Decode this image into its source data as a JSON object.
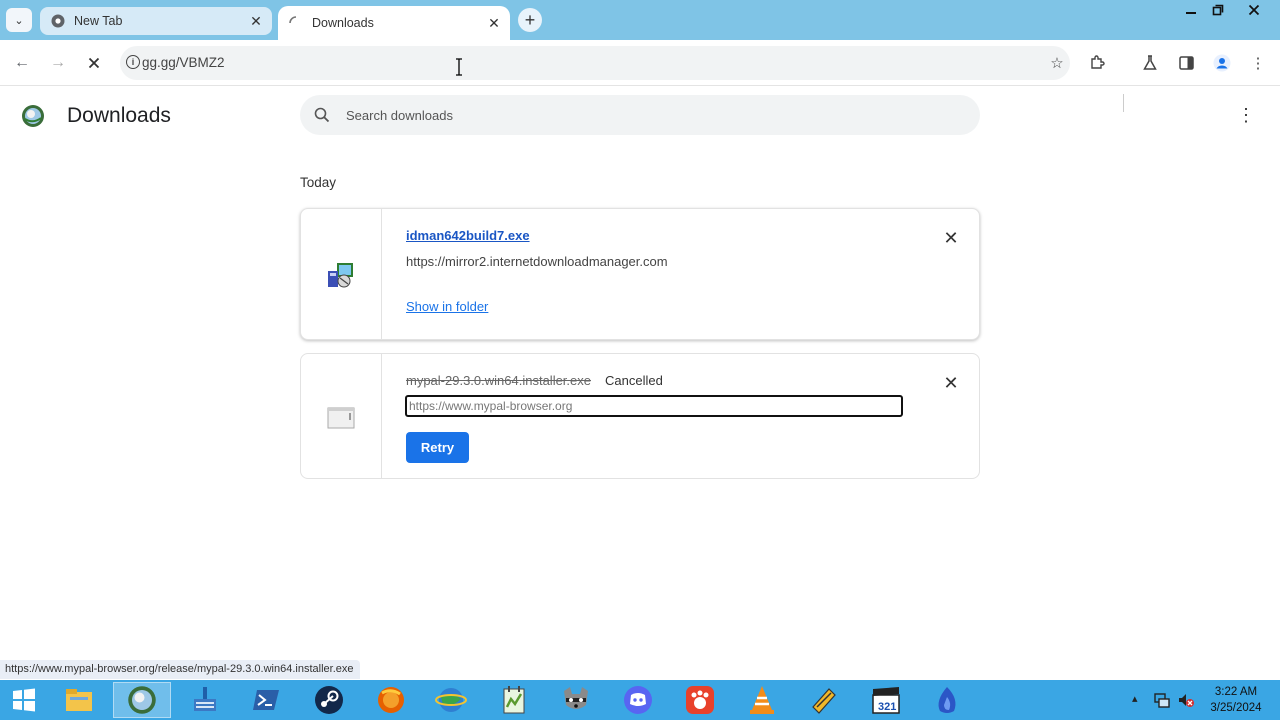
{
  "browser": {
    "tabs": [
      {
        "title": "New Tab",
        "state": "inactive"
      },
      {
        "title": "Downloads",
        "state": "active-loading"
      }
    ],
    "address_bar": {
      "url": "gg.gg/VBMZ2"
    },
    "accent_color": "#7fc4e6"
  },
  "downloads_page": {
    "title": "Downloads",
    "search_placeholder": "Search downloads",
    "section_label": "Today",
    "items": [
      {
        "filename": "idman642build7.exe",
        "source_url": "https://mirror2.internetdownloadmanager.com",
        "action_link": "Show in folder",
        "status": ""
      },
      {
        "filename": "mypal-29.3.0.win64.installer.exe",
        "source_url": "https://www.mypal-browser.org",
        "action_button": "Retry",
        "status": "Cancelled"
      }
    ]
  },
  "status_bar": {
    "hover_url": "https://www.mypal-browser.org/release/mypal-29.3.0.win64.installer.exe"
  },
  "taskbar": {
    "apps": [
      "file-explorer",
      "mypal-browser",
      "network-manager",
      "powershell",
      "steam",
      "firefox",
      "internet-explorer",
      "notepad-plus",
      "raccoon-app",
      "discord",
      "app-red",
      "vlc",
      "tools",
      "media-player-classic",
      "blue-app"
    ],
    "clock_time": "3:22 AM",
    "clock_date": "3/25/2024"
  }
}
